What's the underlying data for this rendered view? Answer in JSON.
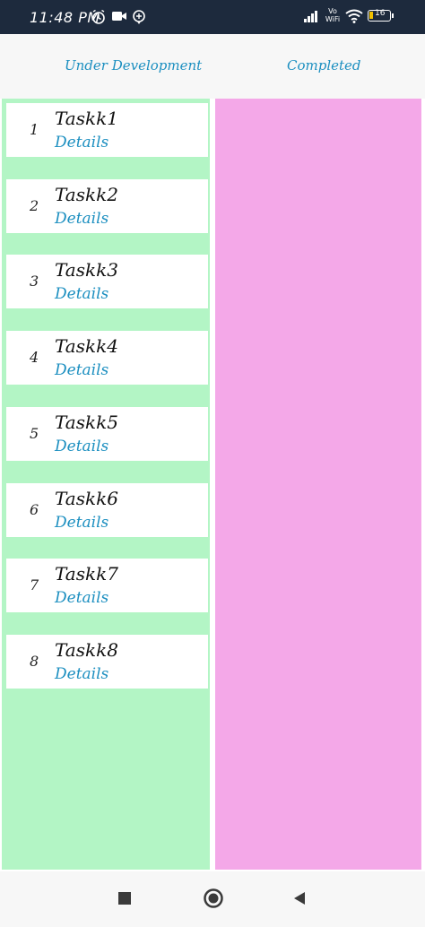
{
  "status_bar": {
    "time": "11:48 PM",
    "icons": [
      "alarm-icon",
      "video-icon",
      "location-icon",
      "signal-icon",
      "vowifi-icon",
      "wifi-icon",
      "battery-icon"
    ],
    "vowifi": "Vo WiFi",
    "battery": "16"
  },
  "header": {
    "columns": [
      "Under Development",
      "Completed"
    ]
  },
  "colors": {
    "accent": "#1c8fc0",
    "under_development_lane": "#b3f5c5",
    "completed_lane": "#f4a8e8",
    "status_bar": "#1d2a3d"
  },
  "tasks": [
    {
      "number": "1",
      "title": "Taskk1",
      "details": "Details"
    },
    {
      "number": "2",
      "title": "Taskk2",
      "details": "Details"
    },
    {
      "number": "3",
      "title": "Taskk3",
      "details": "Details"
    },
    {
      "number": "4",
      "title": "Taskk4",
      "details": "Details"
    },
    {
      "number": "5",
      "title": "Taskk5",
      "details": "Details"
    },
    {
      "number": "6",
      "title": "Taskk6",
      "details": "Details"
    },
    {
      "number": "7",
      "title": "Taskk7",
      "details": "Details"
    },
    {
      "number": "8",
      "title": "Taskk8",
      "details": "Details"
    }
  ],
  "nav": [
    "recent-apps-icon",
    "home-icon",
    "back-icon"
  ]
}
